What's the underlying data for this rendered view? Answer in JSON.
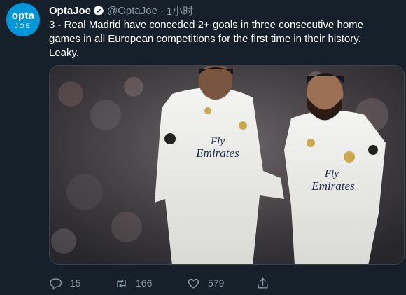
{
  "author": {
    "avatar_line1": "opta",
    "avatar_line2": "JOE",
    "name": "OptaJoe",
    "handle": "@OptaJoe",
    "separator": "·",
    "time": "1小时"
  },
  "tweet": {
    "text_line1": "3 - Real Madrid have conceded 2+ goals in three consecutive home",
    "text_line2": "games in all European competitions for the first time in their history.",
    "text_line3": "Leaky."
  },
  "media": {
    "shirt_text_left_1": "Fly",
    "shirt_text_left_2": "Emirates",
    "shirt_text_right_1": "Fly",
    "shirt_text_right_2": "Emirates"
  },
  "actions": {
    "reply_count": "15",
    "retweet_count": "166",
    "like_count": "579"
  },
  "colors": {
    "background": "#15202b",
    "secondary_text": "#8899a6",
    "accent": "#1da1f2",
    "avatar_bg": "#0097d8"
  },
  "icons": {
    "verified": "verified-badge-icon",
    "reply": "reply-icon",
    "retweet": "retweet-icon",
    "like": "heart-icon",
    "share": "share-icon"
  }
}
